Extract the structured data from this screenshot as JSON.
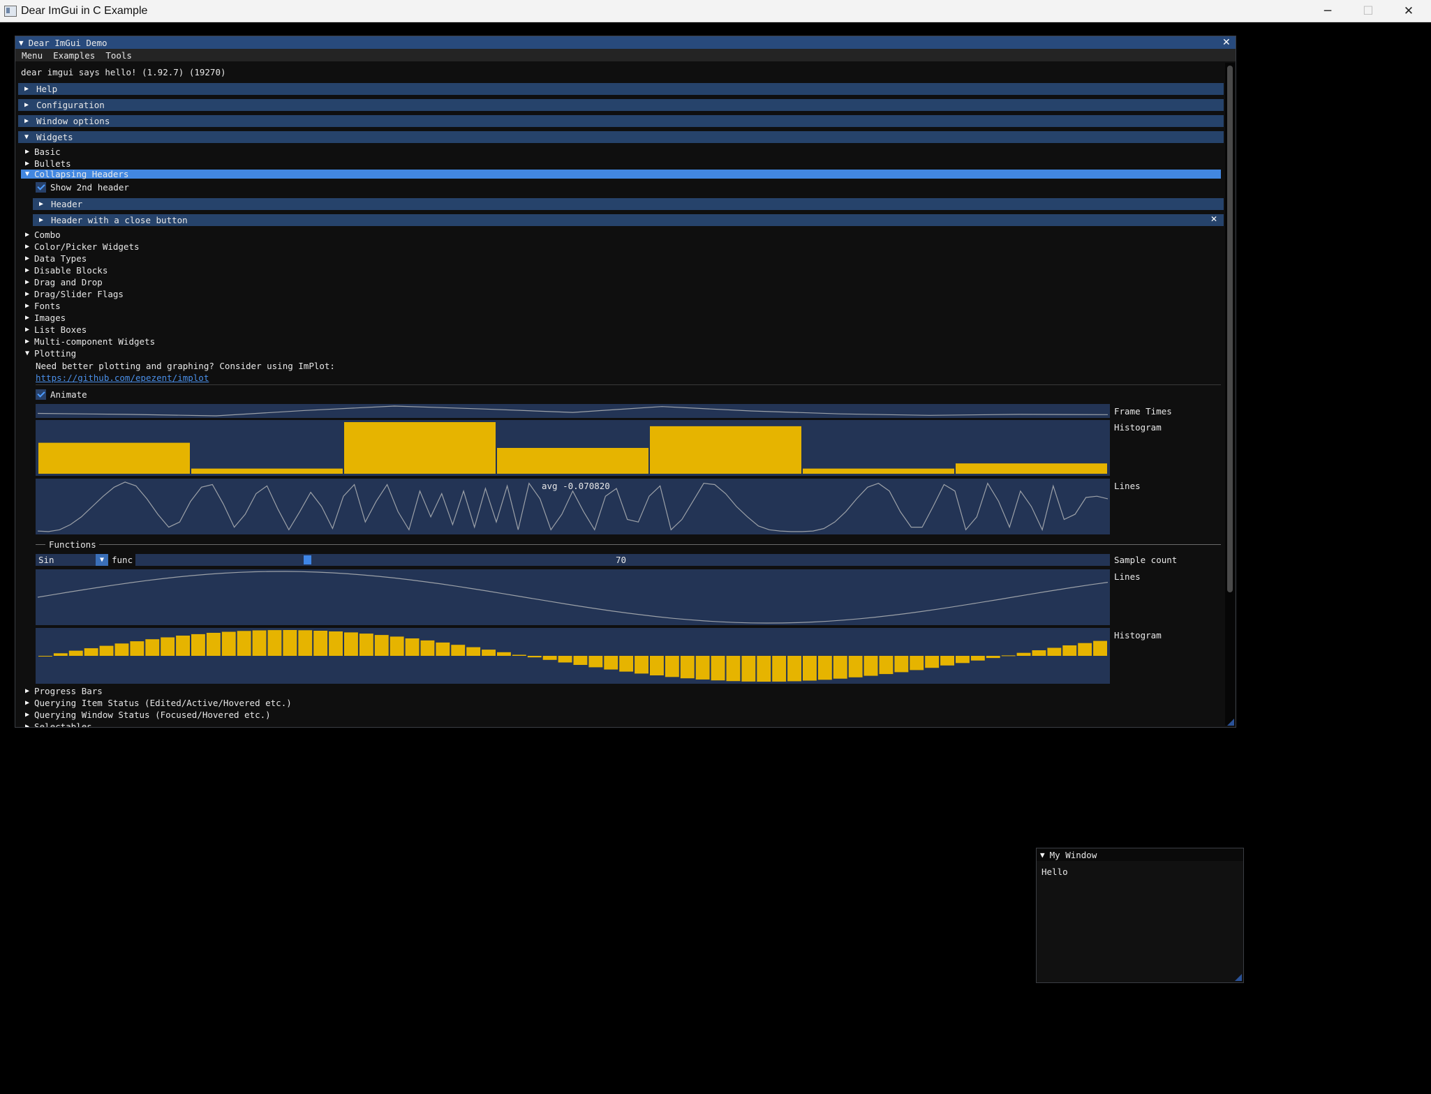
{
  "os_window": {
    "title": "Dear ImGui in C Example"
  },
  "demo": {
    "title": "Dear ImGui Demo",
    "menu": [
      "Menu",
      "Examples",
      "Tools"
    ],
    "hello": "dear imgui says hello! (1.92.7) (19270)",
    "headers": {
      "help": "Help",
      "configuration": "Configuration",
      "window_options": "Window options",
      "widgets": "Widgets"
    },
    "widget_items": {
      "basic": "Basic",
      "bullets": "Bullets",
      "collapsing_headers": "Collapsing Headers",
      "show_2nd_header": "Show 2nd header",
      "header": "Header",
      "header_close": "Header with a close button",
      "combo": "Combo",
      "color_picker": "Color/Picker Widgets",
      "data_types": "Data Types",
      "disable_blocks": "Disable Blocks",
      "drag_and_drop": "Drag and Drop",
      "drag_slider_flags": "Drag/Slider Flags",
      "fonts": "Fonts",
      "images": "Images",
      "list_boxes": "List Boxes",
      "multi_component": "Multi-component Widgets",
      "plotting": "Plotting",
      "progress_bars": "Progress Bars",
      "querying_item": "Querying Item Status (Edited/Active/Hovered etc.)",
      "querying_window": "Querying Window Status (Focused/Hovered etc.)",
      "selectables": "Selectables"
    },
    "plotting": {
      "hint": "Need better plotting and graphing? Consider using ImPlot:",
      "link": "https://github.com/epezent/implot",
      "animate_label": "Animate",
      "frame_times_label": "Frame Times",
      "histogram_label": "Histogram",
      "lines_label": "Lines",
      "lines_overlay": "avg -0.070820",
      "functions_label": "Functions",
      "func_combo_value": "Sin",
      "func_label": "func",
      "sample_count_value": "70",
      "sample_count_label": "Sample count",
      "sample_count_max": 400,
      "func_lines_label": "Lines",
      "func_hist_label": "Histogram"
    }
  },
  "my_window": {
    "title": "My Window",
    "body": "Hello"
  },
  "colors": {
    "header": "#26436b",
    "header_selected": "#4287e0",
    "title_active": "#284a7c",
    "plot_bg": "#233455",
    "plot_hist": "#e6b400",
    "plot_line": "#9ca1a8",
    "check": "#4d9cff"
  },
  "chart_data": [
    {
      "type": "line",
      "name": "frame-times",
      "label": "Frame Times",
      "x": [
        0,
        1,
        2,
        3,
        4,
        5,
        6,
        7,
        8,
        9,
        10,
        11,
        12
      ],
      "values": [
        0.25,
        0.15,
        0.0,
        0.55,
        1.0,
        0.7,
        0.35,
        0.95,
        0.5,
        0.2,
        0.05,
        0.15,
        0.12
      ],
      "ylim": [
        0,
        1
      ]
    },
    {
      "type": "bar",
      "name": "histogram",
      "label": "Histogram",
      "values": [
        0.6,
        0.1,
        1.0,
        0.5,
        0.92,
        0.1,
        0.2
      ],
      "ylim": [
        0,
        1
      ]
    },
    {
      "type": "line",
      "name": "lines",
      "label": "Lines",
      "overlay": "avg -0.070820",
      "ylim": [
        -1,
        1
      ],
      "values": [
        -0.95,
        -0.97,
        -0.9,
        -0.7,
        -0.4,
        0.0,
        0.4,
        0.75,
        0.95,
        0.8,
        0.3,
        -0.3,
        -0.8,
        -0.6,
        0.2,
        0.75,
        0.85,
        0.1,
        -0.8,
        -0.3,
        0.5,
        0.8,
        -0.1,
        -0.9,
        -0.2,
        0.55,
        0.0,
        -0.85,
        0.4,
        0.85,
        -0.6,
        0.2,
        0.85,
        -0.2,
        -0.9,
        0.6,
        -0.4,
        0.5,
        -0.7,
        0.6,
        -0.8,
        0.7,
        -0.6,
        0.8,
        -0.9,
        0.9,
        0.3,
        -0.9,
        -0.3,
        0.6,
        -0.2,
        -0.9,
        0.4,
        0.7,
        -0.5,
        -0.6,
        0.4,
        0.8,
        -0.9,
        -0.5,
        0.2,
        0.9,
        0.85,
        0.5,
        0.0,
        -0.4,
        -0.75,
        -0.9,
        -0.95,
        -0.97,
        -0.97,
        -0.95,
        -0.85,
        -0.6,
        -0.2,
        0.3,
        0.75,
        0.9,
        0.6,
        -0.2,
        -0.8,
        -0.8,
        0.0,
        0.85,
        0.6,
        -0.9,
        -0.4,
        0.9,
        0.2,
        -0.8,
        0.6,
        0.0,
        -0.9,
        0.8,
        -0.5,
        -0.3,
        0.35,
        0.4,
        0.3
      ]
    },
    {
      "type": "line",
      "name": "func-lines",
      "label": "Lines",
      "function": "Sin",
      "ylim": [
        -1,
        1
      ],
      "samples": 70
    },
    {
      "type": "bar",
      "name": "func-histogram",
      "label": "Histogram",
      "function": "Sin",
      "ylim": [
        -1,
        1
      ],
      "samples": 70
    }
  ]
}
